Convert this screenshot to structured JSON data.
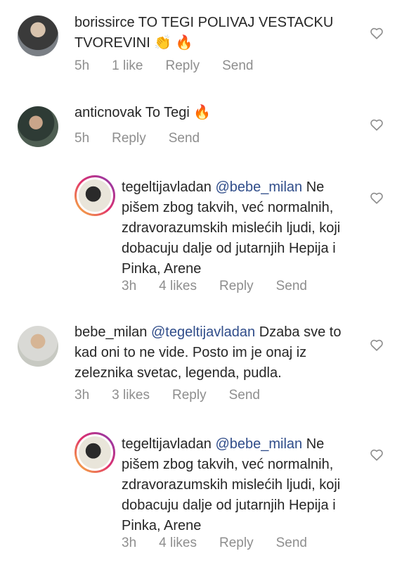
{
  "comments": [
    {
      "username": "borissirce",
      "text": "TO TEGI POLIVAJ VESTACKU TVOREVINI 👏 🔥",
      "time": "5h",
      "likes": "1 like",
      "reply": "Reply",
      "send": "Send"
    },
    {
      "username": "anticnovak",
      "text": "To Tegi 🔥",
      "time": "5h",
      "reply": "Reply",
      "send": "Send"
    },
    {
      "username": "tegeltijavladan",
      "mention": "@bebe_milan",
      "text": "Ne pišem zbog takvih, već normalnih, zdravorazumskih mislećih ljudi, koji dobacuju dalje od jutarnjih Hepija i Pinka, Arene",
      "time": "3h",
      "likes": "4 likes",
      "reply": "Reply",
      "send": "Send"
    },
    {
      "username": "bebe_milan",
      "mention": "@tegeltijavladan",
      "text": "Dzaba sve to kad oni to ne vide. Posto im je onaj iz zeleznika svetac, legenda, pudla.",
      "time": "3h",
      "likes": "3 likes",
      "reply": "Reply",
      "send": "Send"
    },
    {
      "username": "tegeltijavladan",
      "mention": "@bebe_milan",
      "text": "Ne pišem zbog takvih, već normalnih, zdravorazumskih mislećih ljudi, koji dobacuju dalje od jutarnjih Hepija i Pinka, Arene",
      "time": "3h",
      "likes": "4 likes",
      "reply": "Reply",
      "send": "Send"
    }
  ],
  "icons": {
    "like": "heart-outline-icon"
  }
}
